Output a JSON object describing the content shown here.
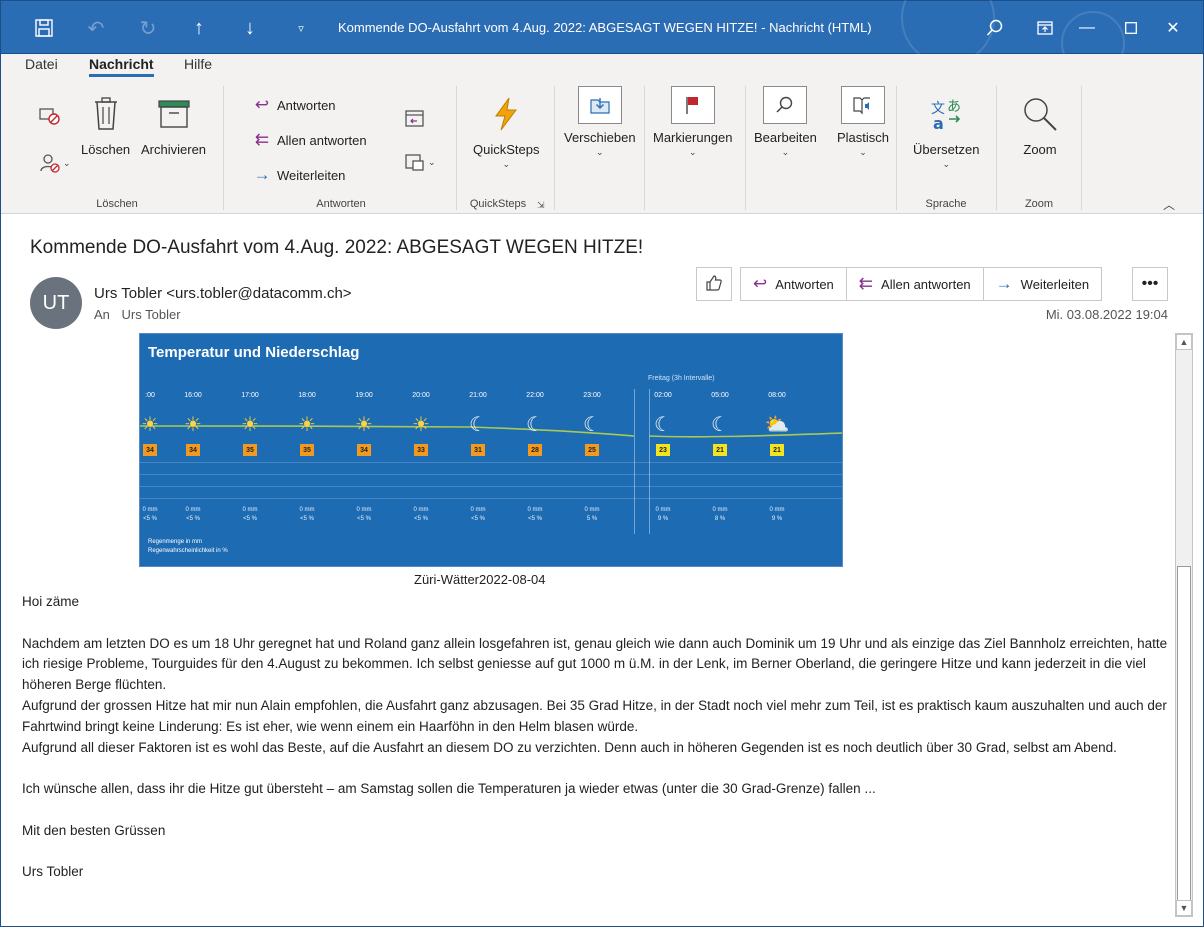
{
  "titlebar": {
    "title": "Kommende DO-Ausfahrt vom 4.Aug. 2022: ABGESAGT WEGEN HITZE!  -  Nachricht (HTML)",
    "save_icon": "save-icon",
    "undo_icon": "undo-icon",
    "redo_icon": "redo-icon",
    "up_icon": "arrow-up-icon",
    "down_icon": "arrow-down-icon",
    "qat_icon": "customize-caret-icon",
    "search_icon": "search-icon",
    "ribbon_display_icon": "ribbon-display-icon",
    "minimize_icon": "minimize-icon",
    "maximize_icon": "maximize-icon",
    "close_icon": "close-icon"
  },
  "ribbon_tabs": [
    "Datei",
    "Nachricht",
    "Hilfe"
  ],
  "ribbon": {
    "loeschen_group": {
      "label": "Löschen",
      "delete": "Löschen",
      "archive": "Archivieren"
    },
    "antworten_group": {
      "label": "Antworten",
      "reply": "Antworten",
      "reply_all": "Allen antworten",
      "forward": "Weiterleiten"
    },
    "quicksteps_group": {
      "label": "QuickSteps",
      "button": "QuickSteps"
    },
    "move": "Verschieben",
    "tags": "Markierungen",
    "edit": "Bearbeiten",
    "immersive": "Plastisch",
    "sprache_group": {
      "label": "Sprache",
      "translate": "Übersetzen"
    },
    "zoom_group": {
      "label": "Zoom",
      "zoom": "Zoom"
    },
    "colors": {
      "flag": "#c4262e",
      "quicksteps": "#f0a30a",
      "translate_blue": "#2b6db4",
      "translate_green": "#2e8b57"
    }
  },
  "message": {
    "subject": "Kommende DO-Ausfahrt vom 4.Aug. 2022: ABGESAGT WEGEN HITZE!",
    "avatar_initials": "UT",
    "sender": "Urs Tobler <urs.tobler@datacomm.ch>",
    "to_label": "An",
    "to": "Urs Tobler",
    "date": "Mi. 03.08.2022 19:04",
    "actions": {
      "like_icon": "thumbs-up-icon",
      "reply": "Antworten",
      "reply_all": "Allen antworten",
      "forward": "Weiterleiten",
      "more_icon": "more-icon"
    }
  },
  "weather": {
    "title": "Temperatur und Niederschlag",
    "friday_label": "Freitag (3h Intervalle)",
    "slots": [
      {
        "time": ":00",
        "icon": "sun",
        "temp": "34",
        "mm": "0 mm",
        "pct": "<5 %"
      },
      {
        "time": "16:00",
        "icon": "sun",
        "temp": "34",
        "mm": "0 mm",
        "pct": "<5 %"
      },
      {
        "time": "17:00",
        "icon": "sun",
        "temp": "35",
        "mm": "0 mm",
        "pct": "<5 %"
      },
      {
        "time": "18:00",
        "icon": "sun",
        "temp": "35",
        "mm": "0 mm",
        "pct": "<5 %"
      },
      {
        "time": "19:00",
        "icon": "sun",
        "temp": "34",
        "mm": "0 mm",
        "pct": "<5 %"
      },
      {
        "time": "20:00",
        "icon": "sun",
        "temp": "33",
        "mm": "0 mm",
        "pct": "<5 %"
      },
      {
        "time": "21:00",
        "icon": "moon-cloud",
        "temp": "31",
        "mm": "0 mm",
        "pct": "<5 %"
      },
      {
        "time": "22:00",
        "icon": "moon-cloud",
        "temp": "28",
        "mm": "0 mm",
        "pct": "<5 %"
      },
      {
        "time": "23:00",
        "icon": "moon-cloud",
        "temp": "25",
        "mm": "0 mm",
        "pct": "5 %"
      },
      {
        "time": "02:00",
        "icon": "moon-cloud",
        "temp": "23",
        "mm": "0 mm",
        "pct": "9 %"
      },
      {
        "time": "05:00",
        "icon": "moon",
        "temp": "21",
        "mm": "0 mm",
        "pct": "8 %"
      },
      {
        "time": "08:00",
        "icon": "sun-cloud",
        "temp": "21",
        "mm": "0 mm",
        "pct": "9 %"
      }
    ],
    "legend_line1": "Regenmenge in mm",
    "legend_line2": "Regenwahrscheinlichkeit in %",
    "colors": {
      "bg": "#1d6bb3",
      "hot": "#f29a1f",
      "mild": "#f2e51f"
    }
  },
  "caption": "Züri-Wätter2022-08-04",
  "body": [
    "Hoi zäme",
    "",
    "Nachdem am letzten DO es um 18 Uhr geregnet hat und Roland ganz allein losgefahren ist, genau gleich wie dann auch Dominik um 19 Uhr und als einzige das Ziel Bannholz erreichten, hatte ich riesige Probleme, Tourguides für den 4.August zu bekommen. Ich selbst geniesse auf gut 1000 m ü.M. in der Lenk, im Berner Oberland, die geringere Hitze und kann jederzeit in die viel höheren Berge flüchten.",
    "Aufgrund der grossen Hitze hat mir nun Alain empfohlen, die Ausfahrt ganz abzusagen. Bei 35 Grad Hitze, in der Stadt noch viel mehr zum Teil, ist es praktisch kaum auszuhalten und auch der Fahrtwind bringt keine Linderung: Es ist eher, wie wenn einem ein Haarföhn in den Helm blasen würde.",
    "Aufgrund all dieser Faktoren ist es wohl das Beste, auf die Ausfahrt an diesem DO zu verzichten. Denn auch in höheren Gegenden ist es noch deutlich über 30 Grad, selbst am Abend.",
    "",
    "Ich wünsche allen, dass ihr die Hitze gut übersteht – am Samstag sollen die Temperaturen ja wieder etwas (unter die 30 Grad-Grenze) fallen ...",
    "",
    "Mit den besten Grüssen",
    "",
    "Urs Tobler"
  ]
}
